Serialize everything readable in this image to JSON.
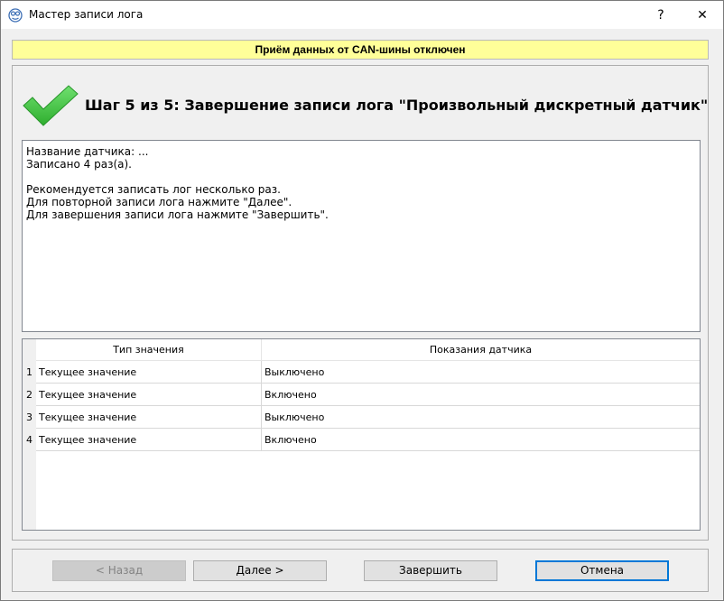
{
  "window": {
    "title": "Мастер записи лога",
    "help_glyph": "?",
    "close_glyph": "✕"
  },
  "banner": {
    "text": "Приём данных от CAN-шины отключен",
    "color": "#ffff99"
  },
  "step": {
    "heading": "Шаг 5 из 5: Завершение записи лога \"Произвольный дискретный датчик\"",
    "icon": "checkmark-icon",
    "icon_color": "#3cc53c"
  },
  "info": {
    "lines": [
      "Название датчика: ...",
      "Записано 4 раз(а).",
      "",
      "Рекомендуется записать лог несколько раз.",
      "Для повторной записи лога нажмите \"Далее\".",
      "Для завершения записи лога нажмите \"Завершить\"."
    ]
  },
  "table": {
    "columns": [
      "Тип значения",
      "Показания датчика"
    ],
    "rows": [
      {
        "num": "1",
        "type": "Текущее значение",
        "value": "Выключено"
      },
      {
        "num": "2",
        "type": "Текущее значение",
        "value": "Включено"
      },
      {
        "num": "3",
        "type": "Текущее значение",
        "value": "Выключено"
      },
      {
        "num": "4",
        "type": "Текущее значение",
        "value": "Включено"
      }
    ]
  },
  "buttons": {
    "back": "< Назад",
    "next": "Далее >",
    "finish": "Завершить",
    "cancel": "Отмена"
  },
  "colors": {
    "accent": "#0078d7"
  }
}
